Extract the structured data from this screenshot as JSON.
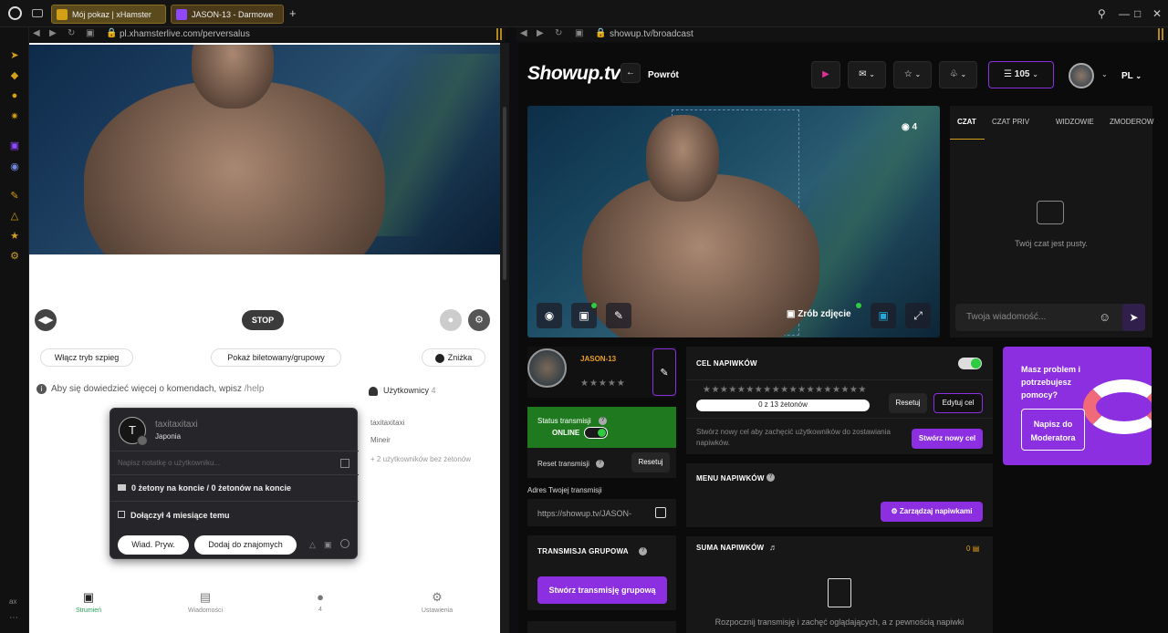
{
  "browser": {
    "tabs": [
      {
        "title": "Mój pokaz | xHamster"
      },
      {
        "title": "JASON-13 - Darmowe"
      }
    ],
    "new_tab": "+",
    "left_url": "pl.xhamsterlive.com/perversalus",
    "right_url": "showup.tv/broadcast",
    "sidebar_footer": "ax",
    "sidebar_more": "⋯"
  },
  "left": {
    "stop_label": "STOP",
    "spy_mode": "Włącz tryb szpieg",
    "ticket_show": "Pokaż biletowany/grupowy",
    "discount": "Zniżka",
    "info_text": "Aby się dowiedzieć więcej o komendach, wpisz",
    "help_cmd": "/help",
    "users_label": "Użytkownicy",
    "users_count": "4",
    "popup": {
      "avatar_letter": "T",
      "username": "taxitaxitaxi",
      "country": "Japonia",
      "note_placeholder": "Napisz notatkę o użytkowniku...",
      "tokens_text": "0 żetony na koncie / 0 żetonów na koncie",
      "joined_text": "Dołączył 4 miesiące temu",
      "pm_button": "Wiad. Pryw.",
      "add_friend_button": "Dodaj do znajomych"
    },
    "user_list": {
      "first": "taxitaxitaxi",
      "second": "Mineir",
      "more": "+ 2 użytkowników bez żetonów"
    },
    "bottom_nav": [
      {
        "label": "Strumień"
      },
      {
        "label": "Wiadomości"
      },
      {
        "label": "4"
      },
      {
        "label": "Ustawienia"
      }
    ]
  },
  "right": {
    "logo": "Showup.tv",
    "back_label": "Powrót",
    "tokens": "105",
    "language": "PL",
    "viewers": "4",
    "snapshot_label": "Zrób zdjęcie",
    "chat": {
      "tabs": [
        "CZAT",
        "CZAT PRIV",
        "WIDZOWIE",
        "ZMODEROW"
      ],
      "empty_text": "Twój czat jest pusty.",
      "input_placeholder": "Twoja wiadomość..."
    },
    "profile": {
      "name": "JASON-13",
      "stars": "★★★★★"
    },
    "status": {
      "label": "Status transmisji",
      "value": "ONLINE",
      "reset_label": "Reset transmisji",
      "reset_button": "Resetuj"
    },
    "stream_address": {
      "label": "Adres Twojej transmisji",
      "value": "https://showup.tv/JASON-"
    },
    "group": {
      "title": "TRANSMISJA GRUPOWA",
      "button": "Stwórz transmisję grupową"
    },
    "tip_goal": {
      "title": "CEL NAPIWKÓW",
      "stars": "★★★★★★★★★★★★★★★★★★★",
      "progress_text": "0 z 13 żetonów",
      "progress": 0,
      "reset_button": "Resetuj",
      "edit_button": "Edytuj cel",
      "desc": "Stwórz nowy cel aby zachęcić użytkowników do zostawiania napiwków.",
      "create_button": "Stwórz nowy cel"
    },
    "tip_menu": {
      "title": "MENU NAPIWKÓW",
      "manage_button": "Zarządzaj napiwkami"
    },
    "tip_sum": {
      "title": "SUMA NAPIWKÓW",
      "value": "0",
      "desc": "Rozpocznij transmisję i zachęć oglądających, a z pewnością napiwki"
    },
    "promo": {
      "text": "Masz problem i potrzebujesz pomocy?",
      "button": "Napisz do Moderatora"
    }
  },
  "colors": {
    "accent_purple": "#8b2fe0",
    "online_green": "#1f7a1f",
    "gold": "#d4a017"
  }
}
